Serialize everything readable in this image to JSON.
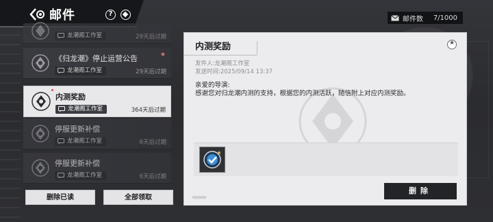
{
  "header": {
    "title": "邮件",
    "mail_count_label": "邮件数",
    "mail_count_value": "7/1000"
  },
  "mails": [
    {
      "name": "",
      "sender": "龙潮阁工作室",
      "expire": "29天后过期",
      "state": "dim"
    },
    {
      "name": "《归龙潮》停止运营公告",
      "sender": "龙潮阁工作室",
      "expire": "29天后过期",
      "state": "normal",
      "starred": true
    },
    {
      "name": "内测奖励",
      "sender": "龙潮阁工作室",
      "expire": "364天后过期",
      "state": "selected"
    },
    {
      "name": "停服更新补偿",
      "sender": "龙潮阁工作室",
      "expire": "6天后过期",
      "state": "dim"
    },
    {
      "name": "停服更新补偿",
      "sender": "龙潮阁工作室",
      "expire": "6天后过期",
      "state": "dim"
    }
  ],
  "buttons": {
    "delete_read": "删除已读",
    "claim_all": "全部领取",
    "delete": "删除"
  },
  "detail": {
    "title": "内测奖励",
    "sender": "发件人:龙潮阁工作室",
    "sent_time": "发送时间:2025/09/14 13:37",
    "greeting": "亲爱的导演:",
    "body": "感谢您对归龙潮内测的支持，根据您的内测活跃，随信附上对应内测奖励。",
    "attachment_count": "1"
  }
}
